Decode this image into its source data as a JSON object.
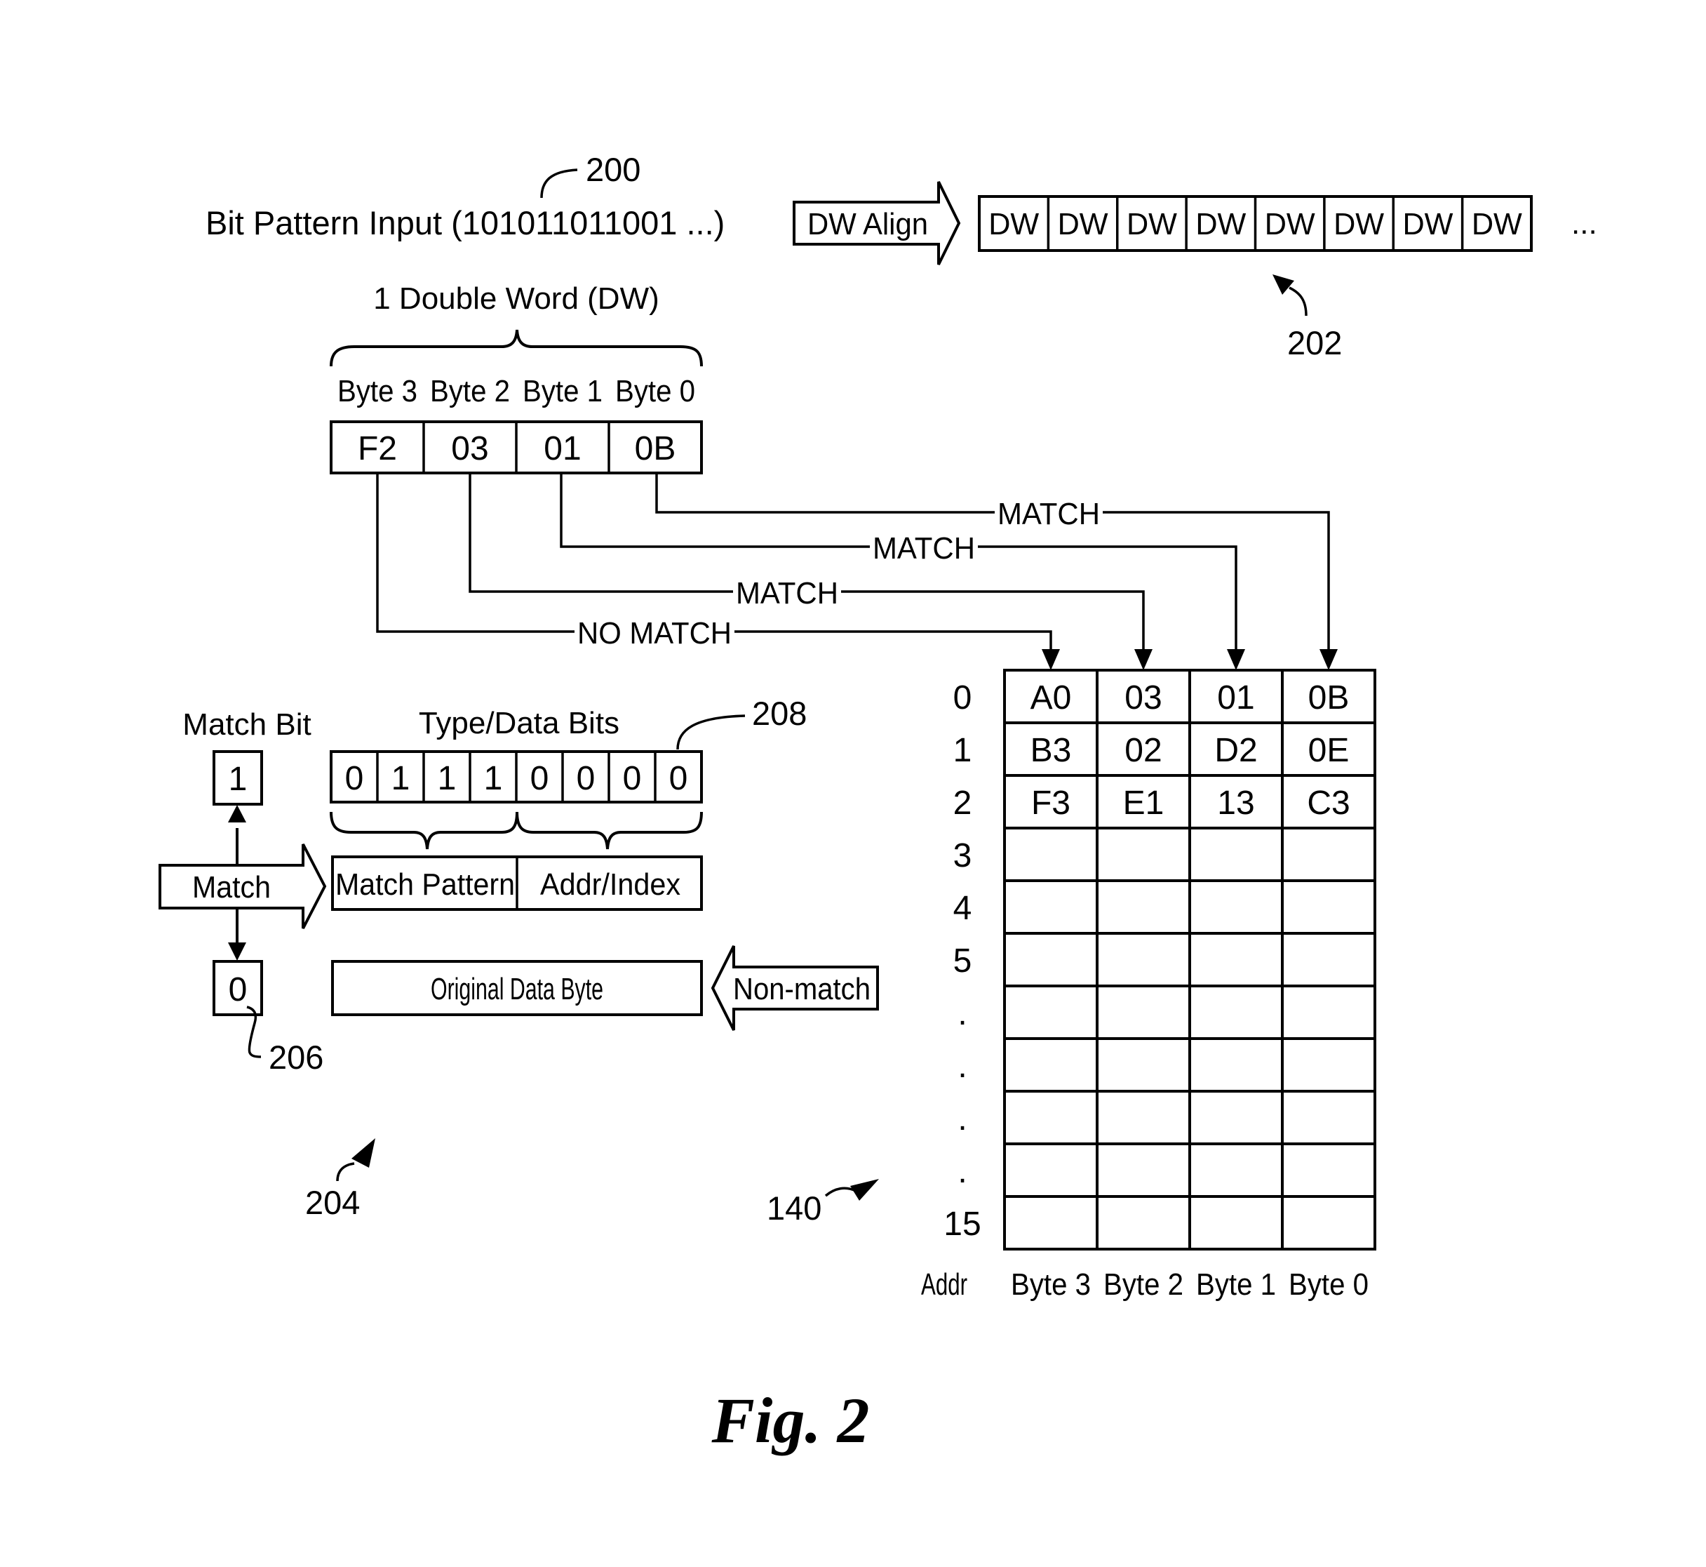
{
  "figure": {
    "caption": "Fig. 2",
    "refs": {
      "r200": "200",
      "r202": "202",
      "r204": "204",
      "r206": "206",
      "r208": "208",
      "r140": "140"
    }
  },
  "input": {
    "label": "Bit Pattern Input (101011011001 ...)",
    "align_arrow_label": "DW Align",
    "dw_cells": [
      "DW",
      "DW",
      "DW",
      "DW",
      "DW",
      "DW",
      "DW",
      "DW"
    ],
    "continuation": "..."
  },
  "double_word": {
    "title": "1 Double Word (DW)",
    "byte_labels": [
      "Byte 3",
      "Byte 2",
      "Byte 1",
      "Byte 0"
    ],
    "byte_values": [
      "F2",
      "03",
      "01",
      "0B"
    ]
  },
  "match_lines": [
    {
      "from_byte": "0B",
      "label": "MATCH",
      "target_column": "Byte 0"
    },
    {
      "from_byte": "01",
      "label": "MATCH",
      "target_column": "Byte 1"
    },
    {
      "from_byte": "03",
      "label": "MATCH",
      "target_column": "Byte 2"
    },
    {
      "from_byte": "F2",
      "label": "NO MATCH",
      "target_column": "Byte 3"
    }
  ],
  "encoding": {
    "match_bit_title": "Match Bit",
    "type_data_title": "Type/Data Bits",
    "match_bit_value_match": "1",
    "match_bit_value_nonmatch": "0",
    "bits": [
      "0",
      "1",
      "1",
      "1",
      "0",
      "0",
      "0",
      "0"
    ],
    "match_arrow_label": "Match",
    "match_pattern_label": "Match Pattern",
    "addr_index_label": "Addr/Index",
    "original_byte_label": "Original Data Byte",
    "nonmatch_arrow_label": "Non-match"
  },
  "table": {
    "row_labels": [
      "0",
      "1",
      "2",
      "3",
      "4",
      "5",
      ".",
      ".",
      ".",
      ".",
      "15"
    ],
    "rows": [
      [
        "A0",
        "03",
        "01",
        "0B"
      ],
      [
        "B3",
        "02",
        "D2",
        "0E"
      ],
      [
        "F3",
        "E1",
        "13",
        "C3"
      ],
      [
        "",
        "",
        "",
        ""
      ],
      [
        "",
        "",
        "",
        ""
      ],
      [
        "",
        "",
        "",
        ""
      ],
      [
        "",
        "",
        "",
        ""
      ],
      [
        "",
        "",
        "",
        ""
      ],
      [
        "",
        "",
        "",
        ""
      ],
      [
        "",
        "",
        "",
        ""
      ],
      [
        "",
        "",
        "",
        ""
      ]
    ],
    "footer_labels": [
      "Addr",
      "Byte 3",
      "Byte 2",
      "Byte 1",
      "Byte 0"
    ]
  }
}
